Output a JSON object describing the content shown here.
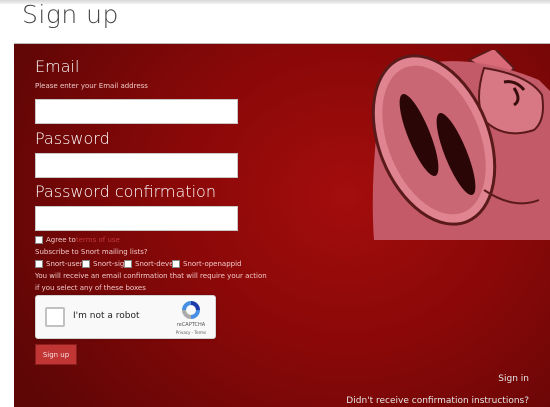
{
  "page": {
    "title": "Sign up"
  },
  "form": {
    "email_label": "Email",
    "email_hint": "Please enter your Email address",
    "email_value": "",
    "password_label": "Password",
    "password_value": "",
    "password_confirmation_label": "Password confirmation",
    "password_confirmation_value": "",
    "agree_prefix": "Agree to",
    "agree_link": "terms of use",
    "subscribe_label": "Subscribe to Snort mailing lists?",
    "mailing_lists": [
      {
        "label": "Snort-users",
        "checked": false
      },
      {
        "label": "Snort-sigs",
        "checked": false
      },
      {
        "label": "Snort-devel",
        "checked": false
      },
      {
        "label": "Snort-openappid",
        "checked": false
      }
    ],
    "confirmation_note_line1": "You will receive an email confirmation that will require your action",
    "confirmation_note_line2": "if you select any of these boxes",
    "submit_label": "Sign up"
  },
  "recaptcha": {
    "label": "I'm not a robot",
    "brand": "reCAPTCHA",
    "links": "Privacy - Terms"
  },
  "links": {
    "sign_in": "Sign in",
    "confirmation_instructions": "Didn't receive confirmation instructions?"
  },
  "colors": {
    "panel_red": "#8a0808",
    "button_red": "#c23535"
  }
}
